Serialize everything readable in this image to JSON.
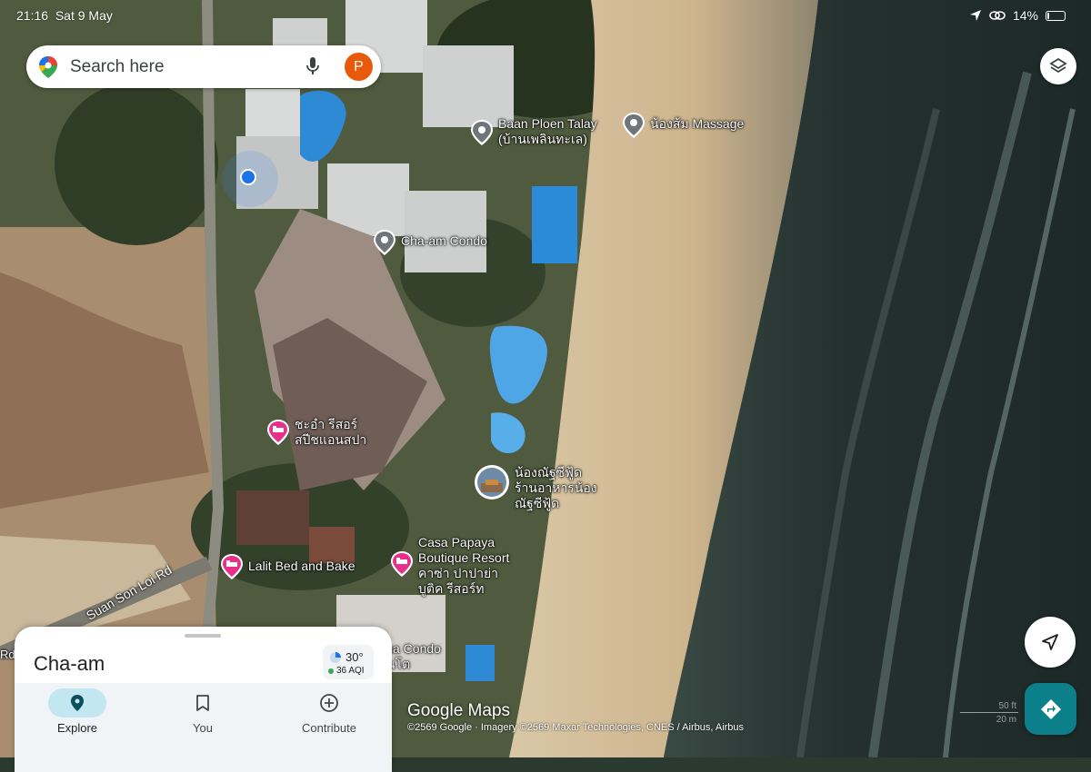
{
  "status_bar": {
    "time": "21:16",
    "date": "Sat 9 May",
    "battery": "14%",
    "battery_level": 0.14
  },
  "search": {
    "placeholder": "Search here",
    "avatar_letter": "P"
  },
  "map": {
    "places": [
      {
        "id": "baan-ploen-talay",
        "name": "Baan Ploen Talay",
        "subname": "(บ้านเพลินทะเล)"
      },
      {
        "id": "nong-som-massage",
        "name": "น้องส้ม Massage"
      },
      {
        "id": "cha-am-condo",
        "name": "Cha-am Condo"
      },
      {
        "id": "cha-am-resort",
        "name": "ชะอำ รีสอร์",
        "subname": "สปีชแอนสปา"
      },
      {
        "id": "nong-seafood",
        "name": "น้องณัฐซีฟู้ด",
        "subname": "ร้านอาหารน้อง",
        "subname2": "ณัฐซีฟู้ด"
      },
      {
        "id": "casa-papaya",
        "name": "Casa Papaya",
        "subname": "Boutique Resort",
        "subname2": "คาซ่า ปาปาย่า",
        "subname3": "บูติค รีสอร์ท"
      },
      {
        "id": "lalit-bed",
        "name": "Lalit Bed and Bake"
      },
      {
        "id": "sa-condo",
        "name": "sa Condo",
        "subname": "นโต"
      }
    ],
    "road_label": "Suan Son Loi Rd",
    "road_label_edge": "Rd",
    "brand": "Google Maps",
    "attribution": "©2569 Google · Imagery ©2569 Maxar Technologies, CNES / Airbus, Airbus",
    "scale_top": "50 ft",
    "scale_bottom": "20 m"
  },
  "sheet": {
    "place_name": "Cha-am",
    "weather": {
      "temp": "30°",
      "aqi": "36 AQI"
    },
    "tabs": [
      {
        "label": "Explore",
        "icon": "pin-icon",
        "active": true
      },
      {
        "label": "You",
        "icon": "bookmark-icon",
        "active": false
      },
      {
        "label": "Contribute",
        "icon": "add-circle-icon",
        "active": false
      }
    ]
  },
  "colors": {
    "accent": "#1a73e8",
    "directions": "#0b7f8a",
    "explore_active": "#c2e7f0",
    "hotel_pin": "#e8308a"
  }
}
